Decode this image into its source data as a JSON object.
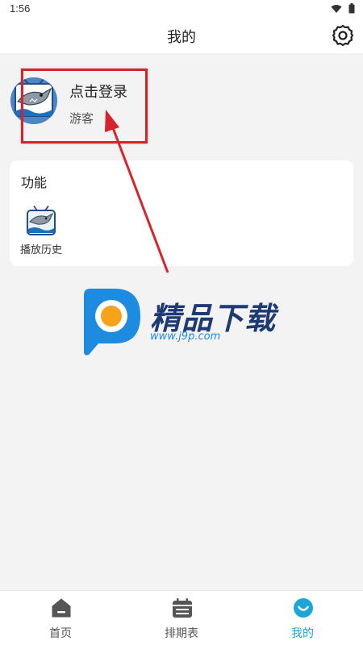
{
  "status_bar": {
    "time": "1:56",
    "icons": [
      "wifi-icon",
      "battery-icon"
    ]
  },
  "header": {
    "title": "我的",
    "settings_icon": "gear-icon"
  },
  "profile": {
    "login_label": "点击登录",
    "guest_label": "游客",
    "avatar_icon": "shark-tv-icon"
  },
  "functions": {
    "title": "功能",
    "items": [
      {
        "label": "播放历史",
        "icon": "shark-tv-icon"
      }
    ]
  },
  "watermark": {
    "brand": "精品下载",
    "url": "www.j9p.com"
  },
  "tabbar": {
    "items": [
      {
        "label": "首页",
        "icon": "home-icon",
        "active": false
      },
      {
        "label": "排期表",
        "icon": "calendar-icon",
        "active": false
      },
      {
        "label": "我的",
        "icon": "smile-icon",
        "active": true
      }
    ]
  },
  "colors": {
    "accent": "#1aa7d8",
    "annotation": "#d9232c",
    "background": "#f3f3f3"
  }
}
